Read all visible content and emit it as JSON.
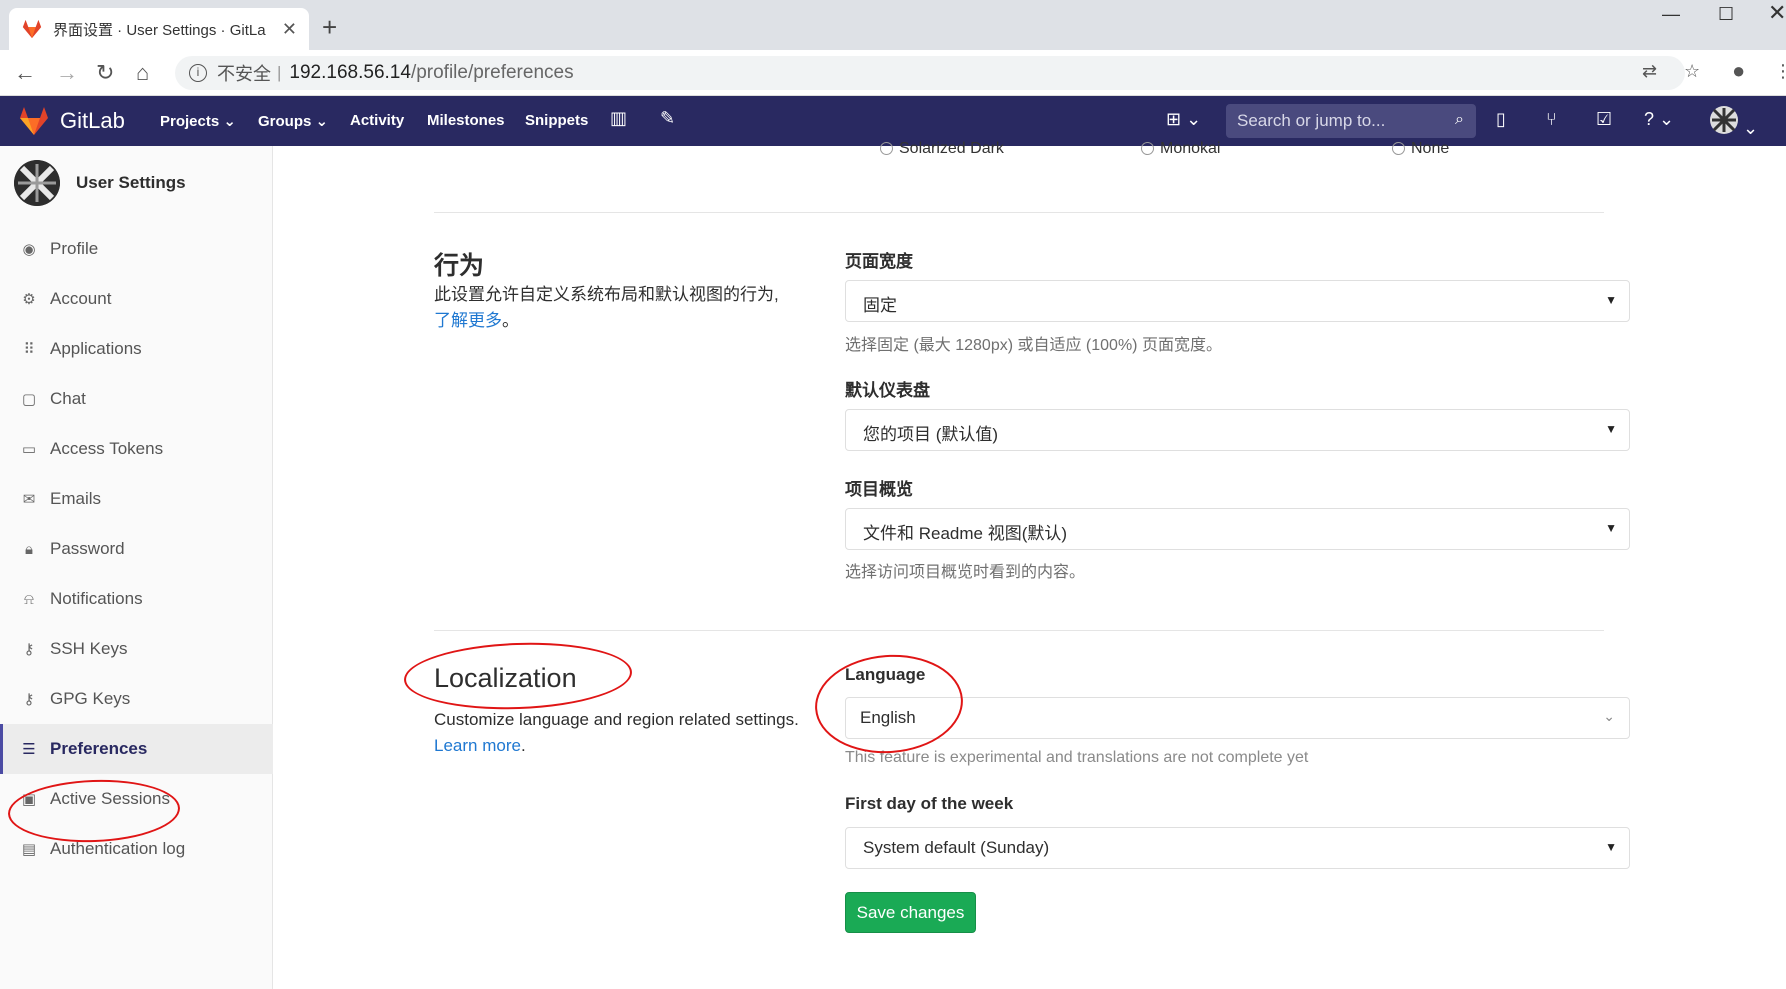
{
  "browser": {
    "tab_title": "界面设置 · User Settings · GitLa",
    "tab_close": "✕",
    "new_tab": "+",
    "url_security": "不安全",
    "url_separator": "|",
    "url_host": "192.168.56.14",
    "url_path": "/profile/preferences"
  },
  "header": {
    "brand": "GitLab",
    "nav": [
      "Projects",
      "Groups",
      "Activity",
      "Milestones",
      "Snippets"
    ],
    "search_placeholder": "Search or jump to..."
  },
  "sidebar": {
    "title": "User Settings",
    "items": [
      {
        "label": "Profile",
        "icon": "profile-icon"
      },
      {
        "label": "Account",
        "icon": "account-icon"
      },
      {
        "label": "Applications",
        "icon": "applications-icon"
      },
      {
        "label": "Chat",
        "icon": "chat-icon"
      },
      {
        "label": "Access Tokens",
        "icon": "token-icon"
      },
      {
        "label": "Emails",
        "icon": "email-icon"
      },
      {
        "label": "Password",
        "icon": "lock-icon"
      },
      {
        "label": "Notifications",
        "icon": "bell-icon"
      },
      {
        "label": "SSH Keys",
        "icon": "key-icon"
      },
      {
        "label": "GPG Keys",
        "icon": "key-icon"
      },
      {
        "label": "Preferences",
        "icon": "sliders-icon",
        "active": true
      },
      {
        "label": "Active Sessions",
        "icon": "monitor-icon"
      },
      {
        "label": "Authentication log",
        "icon": "log-icon"
      }
    ]
  },
  "syntax_themes": [
    "Solarized Dark",
    "Monokai",
    "None"
  ],
  "behavior": {
    "title": "行为",
    "desc": "此设置允许自定义系统布局和默认视图的行为,",
    "learn_more": "了解更多",
    "learn_more_suffix": "。",
    "layout_width_label": "页面宽度",
    "layout_width_value": "固定",
    "layout_width_help": "选择固定 (最大 1280px) 或自适应 (100%) 页面宽度。",
    "dashboard_label": "默认仪表盘",
    "dashboard_value": "您的项目 (默认值)",
    "project_view_label": "项目概览",
    "project_view_value": "文件和 Readme 视图(默认)",
    "project_view_help": "选择访问项目概览时看到的内容。"
  },
  "localization": {
    "title": "Localization",
    "desc": "Customize language and region related settings.",
    "learn_more": "Learn more",
    "learn_more_suffix": ".",
    "language_label": "Language",
    "language_value": "English",
    "language_help": "This feature is experimental and translations are not complete yet",
    "first_day_label": "First day of the week",
    "first_day_value": "System default (Sunday)"
  },
  "save_button": "Save changes",
  "colors": {
    "header_bg": "#292961",
    "save_green": "#1aaa55",
    "link_blue": "#1f78d1",
    "annotation_red": "#e01515"
  }
}
